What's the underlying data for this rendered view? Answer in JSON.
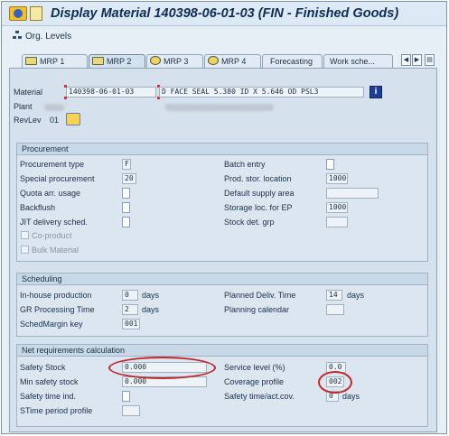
{
  "window": {
    "title": "Display Material 140398-06-01-03 (FIN - Finished Goods)"
  },
  "toolbar": {
    "org_levels_label": "Org. Levels"
  },
  "tabs": [
    {
      "label": "MRP 1",
      "icon": "mrp-icon",
      "active": false
    },
    {
      "label": "MRP 2",
      "icon": "mrp-icon",
      "active": true
    },
    {
      "label": "MRP 3",
      "icon": "mrp-round-icon",
      "active": false
    },
    {
      "label": "MRP 4",
      "icon": "mrp-round-icon",
      "active": false
    },
    {
      "label": "Forecasting",
      "icon": "",
      "active": false
    },
    {
      "label": "Work sche...",
      "icon": "",
      "active": false
    }
  ],
  "header": {
    "material_label": "Material",
    "material_value": "140398-06-01-03",
    "material_desc": "D FACE SEAL 5.380 ID X 5.646 OD PSL3",
    "plant_label": "Plant",
    "revlev_label": "RevLev",
    "revlev_value": "01"
  },
  "procurement": {
    "title": "Procurement",
    "procurement_type_label": "Procurement type",
    "procurement_type_value": "F",
    "special_procurement_label": "Special procurement",
    "special_procurement_value": "20",
    "quota_label": "Quota arr. usage",
    "backflush_label": "Backflush",
    "jit_label": "JIT delivery sched.",
    "coproduct_label": "Co-product",
    "bulk_label": "Bulk Material",
    "batch_entry_label": "Batch entry",
    "prod_stor_label": "Prod. stor. location",
    "prod_stor_value": "1000",
    "default_supply_label": "Default supply area",
    "storage_ep_label": "Storage loc. for EP",
    "storage_ep_value": "1000",
    "stock_det_label": "Stock det. grp"
  },
  "scheduling": {
    "title": "Scheduling",
    "inhouse_label": "In-house production",
    "inhouse_value": "0",
    "inhouse_unit": "days",
    "gr_label": "GR Processing Time",
    "gr_value": "2",
    "gr_unit": "days",
    "schedmargin_label": "SchedMargin key",
    "schedmargin_value": "001",
    "planned_deliv_label": "Planned Deliv. Time",
    "planned_deliv_value": "14",
    "planned_deliv_unit": "days",
    "planning_cal_label": "Planning calendar"
  },
  "netreq": {
    "title": "Net requirements calculation",
    "safety_stock_label": "Safety Stock",
    "safety_stock_value": "0.000",
    "min_safety_label": "Min safety stock",
    "min_safety_value": "0.000",
    "safety_time_ind_label": "Safety time ind.",
    "stime_profile_label": "STime period profile",
    "service_level_label": "Service level (%)",
    "service_level_value": "0.0",
    "coverage_label": "Coverage profile",
    "coverage_value": "002",
    "safety_time_label": "Safety time/act.cov.",
    "safety_time_value": "0",
    "safety_time_unit": "days"
  },
  "colors": {
    "highlight": "#c0282a",
    "title_text": "#0f2d55",
    "group_header": "#c9d8e6"
  }
}
